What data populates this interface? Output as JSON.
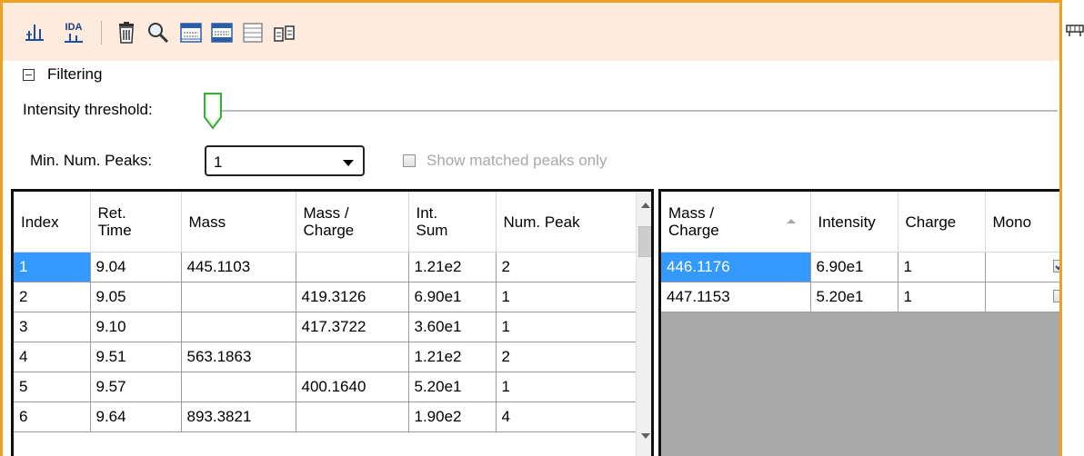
{
  "toolbar": {
    "icons": [
      "peak-list-icon",
      "ida-icon",
      "delete-icon",
      "search-icon",
      "table-view-icon",
      "table-view-alt-icon",
      "list-view-icon",
      "compare-icon"
    ],
    "ida_label": "IDA"
  },
  "filtering": {
    "section_label": "Filtering",
    "intensity_label": "Intensity threshold:",
    "intensity_value": 0,
    "min_peaks_label": "Min. Num. Peaks:",
    "min_peaks_value": "1",
    "show_matched_label": "Show matched peaks only",
    "show_matched_checked": false
  },
  "left_table": {
    "columns": [
      "Index",
      "Ret.\nTime",
      "Mass",
      "Mass /\nCharge",
      "Int.\nSum",
      "Num. Peak"
    ],
    "rows": [
      [
        "1",
        "9.04",
        "445.1103",
        "",
        "1.21e2",
        "2"
      ],
      [
        "2",
        "9.05",
        "",
        "419.3126",
        "6.90e1",
        "1"
      ],
      [
        "3",
        "9.10",
        "",
        "417.3722",
        "3.60e1",
        "1"
      ],
      [
        "4",
        "9.51",
        "563.1863",
        "",
        "1.21e2",
        "2"
      ],
      [
        "5",
        "9.57",
        "",
        "400.1640",
        "5.20e1",
        "1"
      ],
      [
        "6",
        "9.64",
        "893.3821",
        "",
        "1.90e2",
        "4"
      ]
    ],
    "selected_row": 0
  },
  "right_table": {
    "columns": [
      "Mass /\nCharge",
      "Intensity",
      "Charge",
      "Mono"
    ],
    "rows": [
      {
        "mz": "446.1176",
        "intensity": "6.90e1",
        "charge": "1",
        "mono": true
      },
      {
        "mz": "447.1153",
        "intensity": "5.20e1",
        "charge": "1",
        "mono": false
      }
    ],
    "selected_row": 0
  },
  "colors": {
    "accent_border": "#f0a020",
    "toolbar_bg": "#fdebde",
    "selection": "#3399ff",
    "empty_grid": "#a9a9a9"
  }
}
